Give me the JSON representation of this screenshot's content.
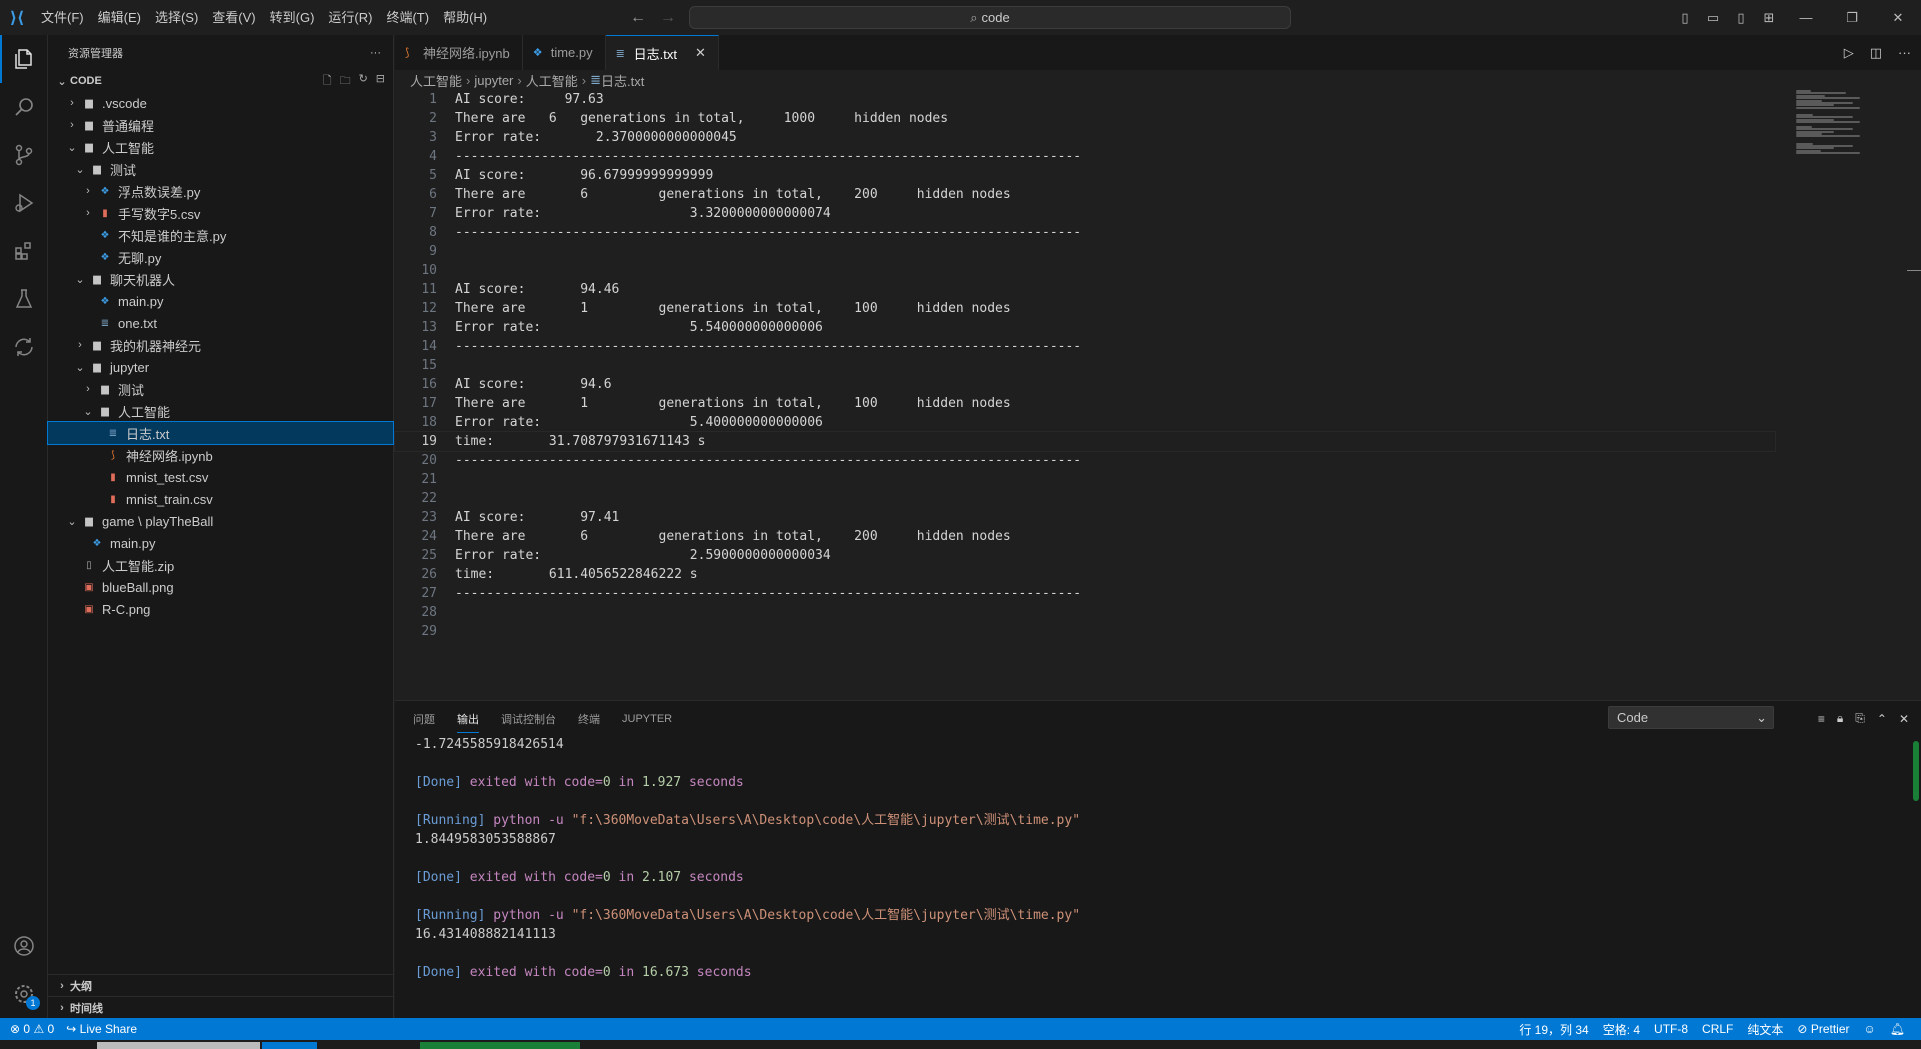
{
  "titlebar": {
    "menu": [
      "文件(F)",
      "编辑(E)",
      "选择(S)",
      "查看(V)",
      "转到(G)",
      "运行(R)",
      "终端(T)",
      "帮助(H)"
    ],
    "search": "code"
  },
  "sidebar": {
    "title": "资源管理器",
    "root": "CODE",
    "tree": [
      {
        "label": ".vscode",
        "depth": 1,
        "type": "folder",
        "expanded": false
      },
      {
        "label": "普通编程",
        "depth": 1,
        "type": "folder",
        "expanded": false
      },
      {
        "label": "人工智能",
        "depth": 1,
        "type": "folder",
        "expanded": true
      },
      {
        "label": "测试",
        "depth": 2,
        "type": "folder",
        "expanded": true
      },
      {
        "label": "浮点数误差.py",
        "depth": 3,
        "type": "py",
        "expanded": false
      },
      {
        "label": "手写数字5.csv",
        "depth": 3,
        "type": "csv",
        "expanded": false
      },
      {
        "label": "不知是谁的主意.py",
        "depth": 3,
        "type": "py"
      },
      {
        "label": "无聊.py",
        "depth": 3,
        "type": "py"
      },
      {
        "label": "聊天机器人",
        "depth": 2,
        "type": "folder",
        "expanded": true
      },
      {
        "label": "main.py",
        "depth": 3,
        "type": "py"
      },
      {
        "label": "one.txt",
        "depth": 3,
        "type": "txt"
      },
      {
        "label": "我的机器神经元",
        "depth": 2,
        "type": "folder",
        "expanded": false
      },
      {
        "label": "jupyter",
        "depth": 2,
        "type": "folder",
        "expanded": true
      },
      {
        "label": "测试",
        "depth": 3,
        "type": "folder",
        "expanded": false
      },
      {
        "label": "人工智能",
        "depth": 3,
        "type": "folder",
        "expanded": true
      },
      {
        "label": "日志.txt",
        "depth": 4,
        "type": "txt",
        "selected": true
      },
      {
        "label": "神经网络.ipynb",
        "depth": 4,
        "type": "ipynb"
      },
      {
        "label": "mnist_test.csv",
        "depth": 4,
        "type": "csv"
      },
      {
        "label": "mnist_train.csv",
        "depth": 4,
        "type": "csv"
      },
      {
        "label": "game \\ playTheBall",
        "depth": 1,
        "type": "folder",
        "expanded": true
      },
      {
        "label": "main.py",
        "depth": 2,
        "type": "py"
      },
      {
        "label": "人工智能.zip",
        "depth": 1,
        "type": "zip"
      },
      {
        "label": "blueBall.png",
        "depth": 1,
        "type": "png"
      },
      {
        "label": "R-C.png",
        "depth": 1,
        "type": "png"
      }
    ],
    "outline": "大纲",
    "timeline": "时间线"
  },
  "tabs": [
    {
      "label": "神经网络.ipynb",
      "type": "ipynb",
      "active": false
    },
    {
      "label": "time.py",
      "type": "py",
      "active": false
    },
    {
      "label": "日志.txt",
      "type": "txt",
      "active": true
    }
  ],
  "breadcrumbs": [
    "人工智能",
    "jupyter",
    "人工智能",
    "日志.txt"
  ],
  "code": [
    "AI score:     97.63",
    "There are   6   generations in total,     1000     hidden nodes",
    "Error rate:       2.3700000000000045",
    "--------------------------------------------------------------------------------",
    "AI score:       96.67999999999999",
    "There are       6         generations in total,    200     hidden nodes",
    "Error rate:                   3.3200000000000074",
    "--------------------------------------------------------------------------------",
    "",
    "",
    "AI score:       94.46",
    "There are       1         generations in total,    100     hidden nodes",
    "Error rate:                   5.540000000000006",
    "--------------------------------------------------------------------------------",
    "",
    "AI score:       94.6",
    "There are       1         generations in total,    100     hidden nodes",
    "Error rate:                   5.400000000000006",
    "time:       31.708797931671143 s",
    "--------------------------------------------------------------------------------",
    "",
    "",
    "AI score:       97.41",
    "There are       6         generations in total,    200     hidden nodes",
    "Error rate:                   2.5900000000000034",
    "time:       611.4056522846222 s",
    "--------------------------------------------------------------------------------",
    "",
    ""
  ],
  "panel": {
    "tabs": [
      "问题",
      "输出",
      "调试控制台",
      "终端",
      "JUPYTER"
    ],
    "active_tab": "输出",
    "channel": "Code",
    "output": [
      {
        "kind": "plain",
        "text": "-1.7245585918426514"
      },
      {
        "kind": "blank"
      },
      {
        "kind": "done",
        "code": "0",
        "time": "1.927"
      },
      {
        "kind": "blank"
      },
      {
        "kind": "run",
        "cmd": "python -u",
        "path": "\"f:\\360MoveData\\Users\\A\\Desktop\\code\\人工智能\\jupyter\\测试\\time.py\""
      },
      {
        "kind": "plain",
        "text": "1.8449583053588867"
      },
      {
        "kind": "blank"
      },
      {
        "kind": "done",
        "code": "0",
        "time": "2.107"
      },
      {
        "kind": "blank"
      },
      {
        "kind": "run",
        "cmd": "python -u",
        "path": "\"f:\\360MoveData\\Users\\A\\Desktop\\code\\人工智能\\jupyter\\测试\\time.py\""
      },
      {
        "kind": "plain",
        "text": "16.431408882141113"
      },
      {
        "kind": "blank"
      },
      {
        "kind": "done",
        "code": "0",
        "time": "16.673"
      }
    ],
    "words": {
      "done": "[Done]",
      "exited": "exited with",
      "code": "code=",
      "in": "in",
      "seconds": "seconds",
      "running": "[Running]"
    }
  },
  "status": {
    "errors": "0",
    "warnings": "0",
    "liveshare": "Live Share",
    "position": "行 19，列 34",
    "spaces": "空格: 4",
    "encoding": "UTF-8",
    "eol": "CRLF",
    "language": "纯文本",
    "prettier": "Prettier"
  },
  "activity_badge": "1",
  "current_line": 19
}
